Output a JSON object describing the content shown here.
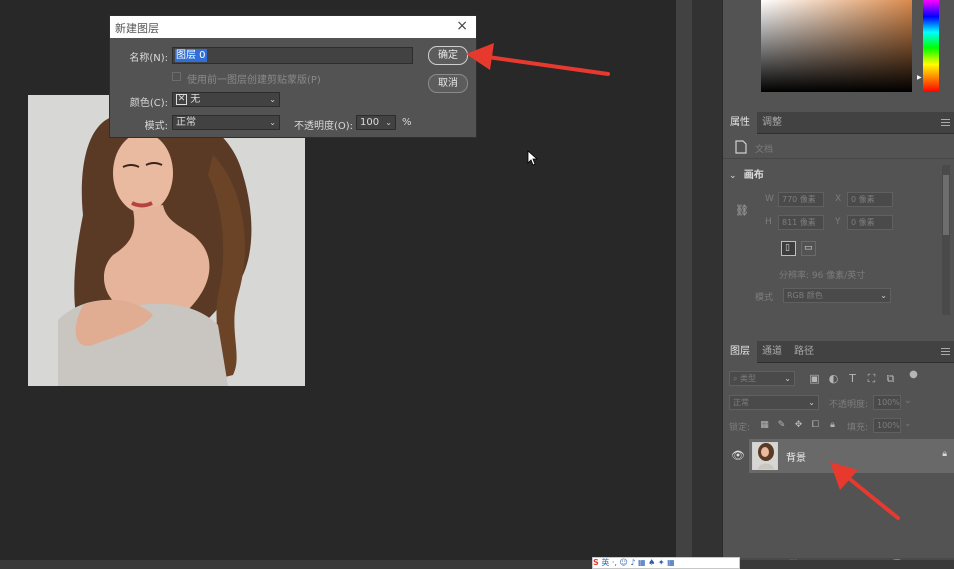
{
  "dialog": {
    "title": "新建图层",
    "close_label": "×",
    "name_label": "名称(N):",
    "name_value": "图层 0",
    "clip_checkbox_label": "使用前一图层创建剪贴蒙版(P)",
    "color_label": "颜色(C):",
    "color_value": "无",
    "mode_label": "模式:",
    "mode_value": "正常",
    "opacity_label": "不透明度(O):",
    "opacity_value": "100",
    "opacity_unit": "%",
    "ok_label": "确定",
    "cancel_label": "取消"
  },
  "properties_panel": {
    "tab_properties": "属性",
    "tab_adjustments": "调整",
    "doc_label": "文档",
    "section_canvas": "画布",
    "w_label": "W",
    "w_value": "770 像素",
    "h_label": "H",
    "h_value": "811 像素",
    "x_label": "X",
    "x_value": "0 像素",
    "y_label": "Y",
    "y_value": "0 像素",
    "resolution": "分辨率: 96 像素/英寸",
    "mode_label": "模式",
    "mode_value": "RGB 颜色"
  },
  "layers_panel": {
    "tab_layers": "图层",
    "tab_channels": "通道",
    "tab_paths": "路径",
    "filter_placeholder": "类型",
    "blend_mode": "正常",
    "opacity_label": "不透明度:",
    "opacity_value": "100%",
    "lock_label": "锁定:",
    "fill_label": "填充:",
    "fill_value": "100%",
    "layers": [
      {
        "name": "背景",
        "visible": true,
        "locked": true
      }
    ]
  },
  "ime_toolbar": {
    "text": "英 ·, ☺ ♪ ▦ ♠ ✦ ▦"
  },
  "colors": {
    "workspace": "#282828",
    "panel": "#535353",
    "dialog_bg": "#535353",
    "selection": "#2f6fd7",
    "annotation_arrow": "#e8392f"
  }
}
